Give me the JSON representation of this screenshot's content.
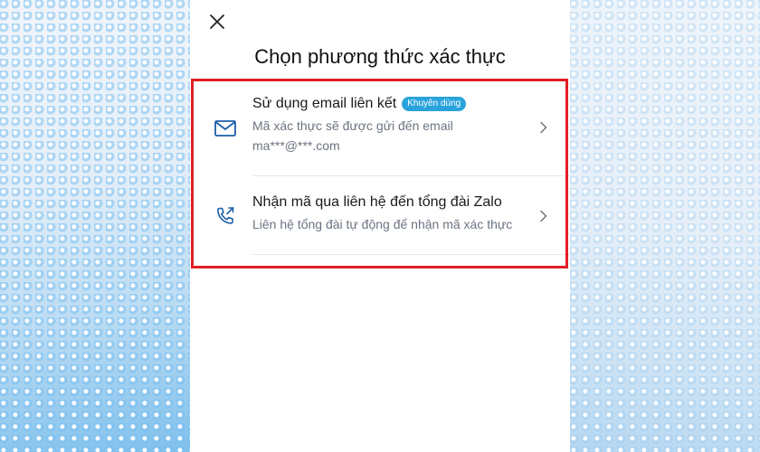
{
  "header": {
    "title": "Chọn phương thức xác thực"
  },
  "options": [
    {
      "title": "Sử dụng email liên kết",
      "badge": "Khuyên dùng",
      "description_line1": "Mã xác thực sẽ được gửi đến email",
      "description_line2": "ma***@***.com",
      "icon": "mail-icon"
    },
    {
      "title": "Nhận mã qua liên hệ đến tổng đài Zalo",
      "description_line1": "Liên hệ tổng đài tự động để nhận mã xác thực",
      "icon": "phone-call-icon"
    }
  ],
  "colors": {
    "accent": "#2aa3dc",
    "icon": "#1d5ea8",
    "highlight": "#e01f26",
    "title": "#111111",
    "subtext": "#6b7480"
  }
}
